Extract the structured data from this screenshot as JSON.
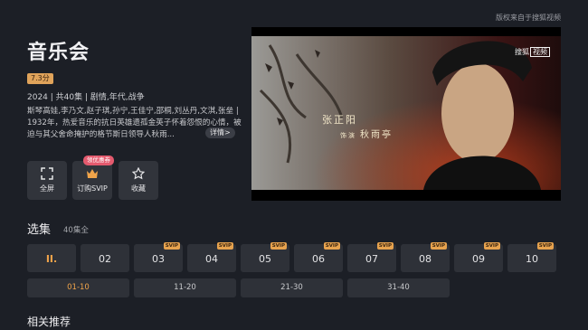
{
  "copyright": "版权来自于搜狐视频",
  "show": {
    "title": "音乐会",
    "score": "7.3分",
    "meta": "2024 | 共40集 | 剧情,年代,战争",
    "description": "斯琴高娃,李乃文,赵子琪,孙宁,王佳宁,邵桐,刘丛丹,文淇,张垒 | 1932年，热爱音乐的抗日英雄遗孤金英子怀着怨恨的心情，被迫与其父舍命掩护的格节斯日领导人秋雨...",
    "more_label": "详情>"
  },
  "actions": [
    {
      "label": "全屏",
      "icon": "fullscreen-icon"
    },
    {
      "label": "订购SVIP",
      "icon": "crown-icon",
      "tag": "领优惠券"
    },
    {
      "label": "收藏",
      "icon": "star-icon"
    }
  ],
  "video": {
    "watermark_brand": "搜狐",
    "watermark_box": "视频",
    "caption_name": "张正阳",
    "caption_role_prefix": "饰演",
    "caption_role": "秋雨亭"
  },
  "episodes": {
    "section_title": "选集",
    "count": "40集全",
    "playing_icon": "II.",
    "items": [
      {
        "label": "02",
        "badge": ""
      },
      {
        "label": "03",
        "badge": "SVIP"
      },
      {
        "label": "04",
        "badge": "SVIP"
      },
      {
        "label": "05",
        "badge": "SVIP"
      },
      {
        "label": "06",
        "badge": "SVIP"
      },
      {
        "label": "07",
        "badge": "SVIP"
      },
      {
        "label": "08",
        "badge": "SVIP"
      },
      {
        "label": "09",
        "badge": "SVIP"
      },
      {
        "label": "10",
        "badge": "SVIP"
      }
    ],
    "ranges": [
      "01-10",
      "11-20",
      "21-30",
      "31-40"
    ]
  },
  "related_title": "相关推荐",
  "colors": {
    "accent": "#f0a44a",
    "background": "#1c1f26",
    "tile": "#2e3138",
    "badge": "#e6a24e",
    "coupon": "#e45a6e"
  }
}
